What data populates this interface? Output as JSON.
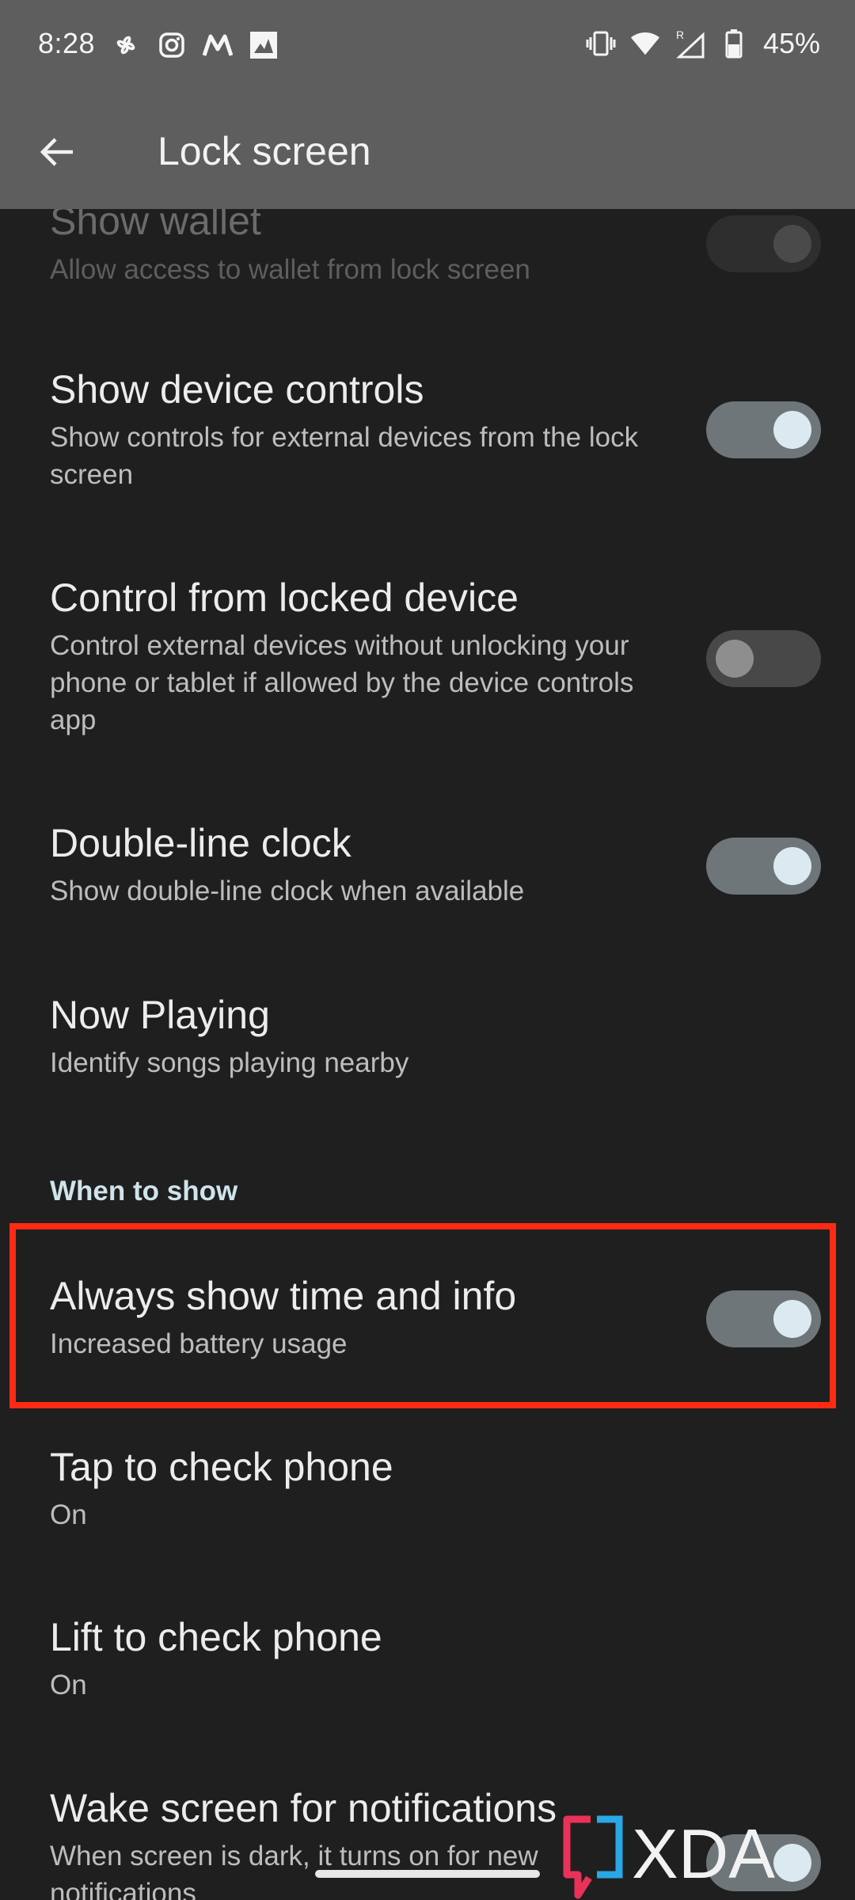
{
  "status_bar": {
    "time": "8:28",
    "left_icons": [
      "pinwheel-icon",
      "instagram-icon",
      "m-app-icon",
      "image-icon"
    ],
    "right_icons": [
      "vibrate-icon",
      "wifi-icon",
      "signal-roaming-icon",
      "battery-icon"
    ],
    "battery_percent": "45%"
  },
  "app_bar": {
    "title": "Lock screen"
  },
  "settings": [
    {
      "title": "Show wallet",
      "summary": "Allow access to wallet from lock screen",
      "toggle": "on",
      "state": "disabled"
    },
    {
      "title": "Show device controls",
      "summary": "Show controls for external devices from the lock screen",
      "toggle": "on"
    },
    {
      "title": "Control from locked device",
      "summary": "Control external devices without unlocking your phone or tablet if allowed by the device controls app",
      "toggle": "off"
    },
    {
      "title": "Double-line clock",
      "summary": "Show double-line clock when available",
      "toggle": "on"
    },
    {
      "title": "Now Playing",
      "summary": "Identify songs playing nearby"
    }
  ],
  "section_header": "When to show",
  "when_to_show": [
    {
      "title": "Always show time and info",
      "summary": "Increased battery usage",
      "toggle": "on",
      "highlighted": true
    },
    {
      "title": "Tap to check phone",
      "summary": "On"
    },
    {
      "title": "Lift to check phone",
      "summary": "On"
    },
    {
      "title": "Wake screen for notifications",
      "summary": "When screen is dark, it turns on for new notifications",
      "toggle": "on"
    }
  ],
  "watermark": {
    "text": "XDA"
  },
  "colors": {
    "background": "#1f1f1f",
    "highlight": "#ff2a14",
    "toggle_on_track": "#6f7679",
    "toggle_on_thumb": "#dbeaf0",
    "section_header": "#cfe3ea"
  }
}
